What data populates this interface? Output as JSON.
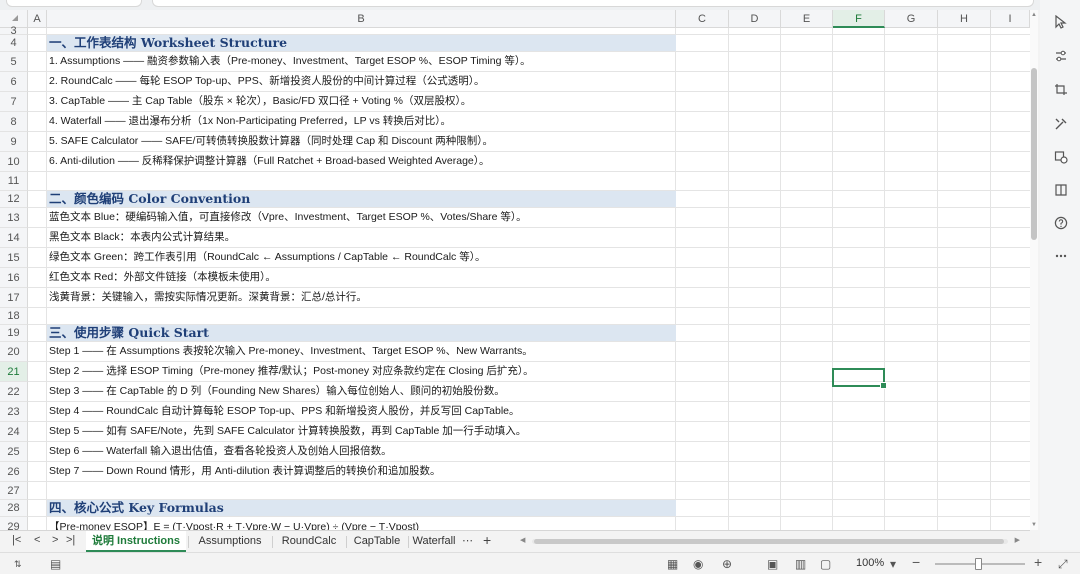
{
  "columns": [
    {
      "label": ""
    },
    {
      "label": "A"
    },
    {
      "label": "B"
    },
    {
      "label": "C"
    },
    {
      "label": "D"
    },
    {
      "label": "E"
    },
    {
      "label": "F"
    },
    {
      "label": "G"
    },
    {
      "label": "H"
    },
    {
      "label": "I"
    }
  ],
  "selected": {
    "column": "F",
    "row": "21"
  },
  "rows": [
    {
      "num": "3",
      "text": "",
      "type": "blank"
    },
    {
      "num": "4",
      "text": "一、工作表结构 Worksheet Structure",
      "type": "header"
    },
    {
      "num": "5",
      "text": "1. Assumptions —— 融资参数输入表（Pre-money、Investment、Target ESOP %、ESOP Timing 等）。",
      "type": "text"
    },
    {
      "num": "6",
      "text": "2. RoundCalc —— 每轮 ESOP Top-up、PPS、新增投资人股份的中间计算过程（公式透明）。",
      "type": "text"
    },
    {
      "num": "7",
      "text": "3. CapTable —— 主 Cap Table（股东 × 轮次），Basic/FD 双口径 + Voting %（双层股权）。",
      "type": "text"
    },
    {
      "num": "8",
      "text": "4. Waterfall —— 退出瀑布分析（1x Non-Participating Preferred，LP vs 转换后对比）。",
      "type": "text"
    },
    {
      "num": "9",
      "text": "5. SAFE Calculator —— SAFE/可转债转换股数计算器（同时处理 Cap 和 Discount 两种限制）。",
      "type": "text"
    },
    {
      "num": "10",
      "text": "6. Anti-dilution —— 反稀释保护调整计算器（Full Ratchet + Broad-based Weighted Average）。",
      "type": "text"
    },
    {
      "num": "11",
      "text": "",
      "type": "blank"
    },
    {
      "num": "12",
      "text": "二、颜色编码 Color Convention",
      "type": "header"
    },
    {
      "num": "13",
      "text": "蓝色文本 Blue：硬编码输入值，可直接修改（Vpre、Investment、Target ESOP %、Votes/Share 等）。",
      "type": "text"
    },
    {
      "num": "14",
      "text": "黑色文本 Black：本表内公式计算结果。",
      "type": "text"
    },
    {
      "num": "15",
      "text": "绿色文本 Green：跨工作表引用（RoundCalc ← Assumptions / CapTable ← RoundCalc 等）。",
      "type": "text"
    },
    {
      "num": "16",
      "text": "红色文本 Red：外部文件链接（本模板未使用）。",
      "type": "text"
    },
    {
      "num": "17",
      "text": "浅黄背景：关键输入，需按实际情况更新。深黄背景：汇总/总计行。",
      "type": "text"
    },
    {
      "num": "18",
      "text": "",
      "type": "blank"
    },
    {
      "num": "19",
      "text": "三、使用步骤 Quick Start",
      "type": "header"
    },
    {
      "num": "20",
      "text": "Step 1 —— 在 Assumptions 表按轮次输入 Pre-money、Investment、Target ESOP %、New Warrants。",
      "type": "text"
    },
    {
      "num": "21",
      "text": "Step 2 —— 选择 ESOP Timing（Pre-money 推荐/默认；Post-money 对应条款约定在 Closing 后扩充）。",
      "type": "text"
    },
    {
      "num": "22",
      "text": "Step 3 —— 在 CapTable 的 D 列（Founding New Shares）输入每位创始人、顾问的初始股份数。",
      "type": "text"
    },
    {
      "num": "23",
      "text": "Step 4 —— RoundCalc 自动计算每轮 ESOP Top-up、PPS 和新增投资人股份，并反写回 CapTable。",
      "type": "text"
    },
    {
      "num": "24",
      "text": "Step 5 —— 如有 SAFE/Note，先到 SAFE Calculator 计算转换股数，再到 CapTable 加一行手动填入。",
      "type": "text"
    },
    {
      "num": "25",
      "text": "Step 6 —— Waterfall 输入退出估值，查看各轮投资人及创始人回报倍数。",
      "type": "text"
    },
    {
      "num": "26",
      "text": "Step 7 —— Down Round 情形，用 Anti-dilution 表计算调整后的转换价和追加股数。",
      "type": "text"
    },
    {
      "num": "27",
      "text": "",
      "type": "blank"
    },
    {
      "num": "28",
      "text": "四、核心公式 Key Formulas",
      "type": "header"
    },
    {
      "num": "29",
      "text": "【Pre-money ESOP】E = (T·Vpost·R + T·Vpre·W − U·Vpre) ÷ (Vpre − T·Vpost)",
      "type": "text"
    }
  ],
  "tabs": [
    {
      "label": "说明 Instructions",
      "active": true
    },
    {
      "label": "Assumptions",
      "active": false
    },
    {
      "label": "RoundCalc",
      "active": false
    },
    {
      "label": "CapTable",
      "active": false
    },
    {
      "label": "Waterfall",
      "active": false
    }
  ],
  "tab_nav": {
    "first": "|<",
    "prev": "<",
    "next": ">",
    "last": ">|",
    "more": "⋯",
    "add": "+"
  },
  "zoom": {
    "label": "100%",
    "minus": "−",
    "plus": "+"
  },
  "right_tools": [
    "pointer-icon",
    "filter-icon",
    "crop-icon",
    "tools-icon",
    "shapes-icon",
    "book-icon",
    "help-icon",
    "more-icon"
  ]
}
